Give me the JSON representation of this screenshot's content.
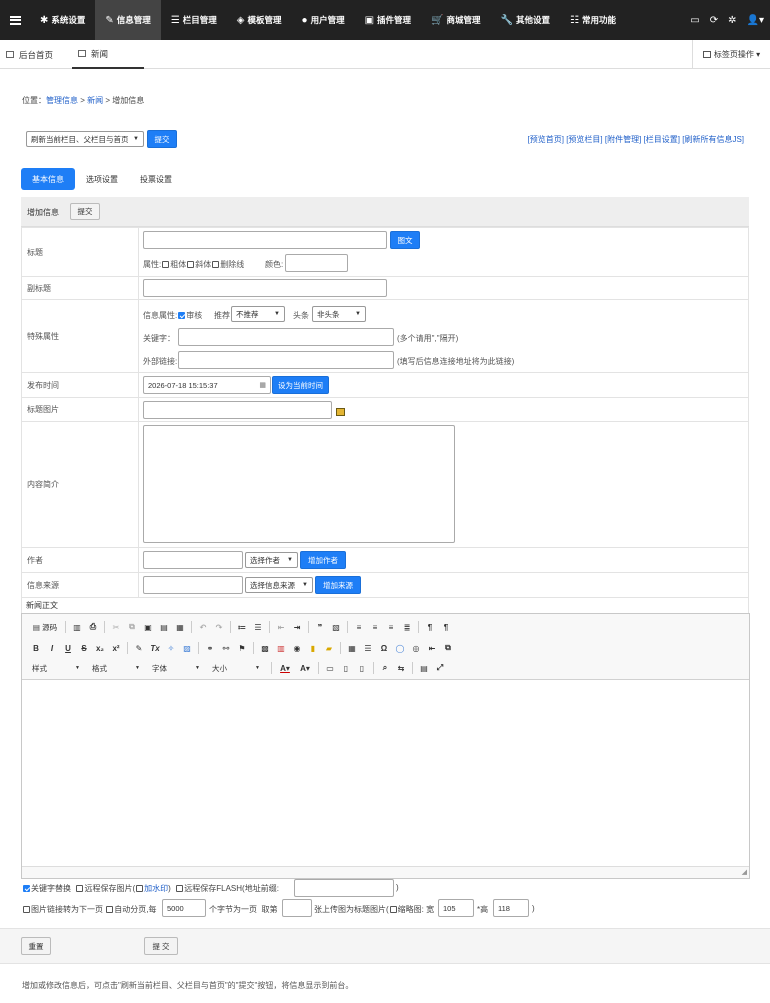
{
  "nav": {
    "items": [
      {
        "label": "系统设置",
        "icon": "gear-icon",
        "glyph": "✱"
      },
      {
        "label": "信息管理",
        "icon": "edit-icon",
        "glyph": "✎"
      },
      {
        "label": "栏目管理",
        "icon": "list-icon",
        "glyph": "☰"
      },
      {
        "label": "模板管理",
        "icon": "layers-icon",
        "glyph": "◈"
      },
      {
        "label": "用户管理",
        "icon": "user-icon",
        "glyph": "●"
      },
      {
        "label": "插件管理",
        "icon": "plugin-icon",
        "glyph": "▣"
      },
      {
        "label": "商城管理",
        "icon": "cart-icon",
        "glyph": "🛒"
      },
      {
        "label": "其他设置",
        "icon": "wrench-icon",
        "glyph": "🔧"
      },
      {
        "label": "常用功能",
        "icon": "sliders-icon",
        "glyph": "☷"
      }
    ],
    "right_icons": [
      {
        "icon": "monitor-icon",
        "glyph": "▭"
      },
      {
        "icon": "refresh-icon",
        "glyph": "⟳"
      },
      {
        "icon": "settings-icon",
        "glyph": "✲"
      },
      {
        "icon": "account-icon",
        "glyph": "👤▾"
      }
    ]
  },
  "tabs": {
    "home": "后台首页",
    "current": "新闻",
    "ops": "标签页操作 ▾"
  },
  "breadcrumb": {
    "prefix": "位置：",
    "link1": "管理信息",
    "sep1": " > ",
    "link2": "新闻",
    "sep2": " > ",
    "current": "增加信息"
  },
  "refresh_select": "刷新当前栏目、父栏目与首页",
  "submit_label": "提交",
  "quick_links": "[预览首页] [预览栏目] [附件管理] [栏目设置] [刷新所有信息JS]",
  "form_tabs": [
    "基本信息",
    "选项设置",
    "投票设置"
  ],
  "section": {
    "title": "增加信息",
    "submit": "提交"
  },
  "fields": {
    "title": {
      "label": "标题",
      "pic_btn": "图文",
      "attr_label": "属性:",
      "bold": "粗体",
      "italic": "斜体",
      "strike": "删除线",
      "color_label": "颜色:"
    },
    "subtitle": {
      "label": "副标题"
    },
    "special": {
      "label": "特殊属性",
      "info_attr": "信息属性:",
      "review": "审核",
      "recommend_label": "推荐",
      "recommend_value": "不推荐",
      "headline_label": "头条",
      "headline_value": "非头条",
      "keyword_label": "关键字",
      "keyword_sep": "：",
      "keyword_hint": "(多个请用\",\"隔开)",
      "link_label": "外部链接:",
      "link_hint": "(填写后信息连接地址将为此链接)"
    },
    "pubtime": {
      "label": "发布时间",
      "value": "2026-07-18 15:15:37",
      "btn": "设为当前时间"
    },
    "titlepic": {
      "label": "标题图片"
    },
    "summary": {
      "label": "内容简介"
    },
    "author": {
      "label": "作者",
      "select": "选择作者",
      "btn": "增加作者"
    },
    "source": {
      "label": "信息来源",
      "select": "选择信息来源",
      "btn": "增加来源"
    }
  },
  "editor": {
    "label": "新闻正文",
    "source_btn": "源码",
    "combos": [
      "样式",
      "格式",
      "字体",
      "大小"
    ]
  },
  "options": {
    "keyword_replace": "关键字替换",
    "remote_img": "远程保存图片(",
    "watermark": "加水印",
    "remote_img_end": ")",
    "remote_flash": "远程保存FLASH(地址前缀:",
    "remote_flash_end": ")",
    "img_link": "图片链接转为下一页",
    "auto_page": "自动分页",
    "per": ",每",
    "per_value": "5000",
    "per_unit": "个字节为一页",
    "take_label": "取第",
    "take_unit": "张上传图为标题图片(",
    "thumb": "缩略图: 宽",
    "thumb_w": "105",
    "thumb_h_label": "*高",
    "thumb_h": "118",
    "end": ")"
  },
  "footer": {
    "reset": "重置",
    "submit": "提 交"
  },
  "note": "增加或修改信息后，可点击\"刷新当前栏目、父栏目与首页\"的\"提交\"按钮，将信息显示到前台。",
  "colors": {
    "accent": "#1e7ef6",
    "topbar": "#222222",
    "link": "#2160c9"
  }
}
